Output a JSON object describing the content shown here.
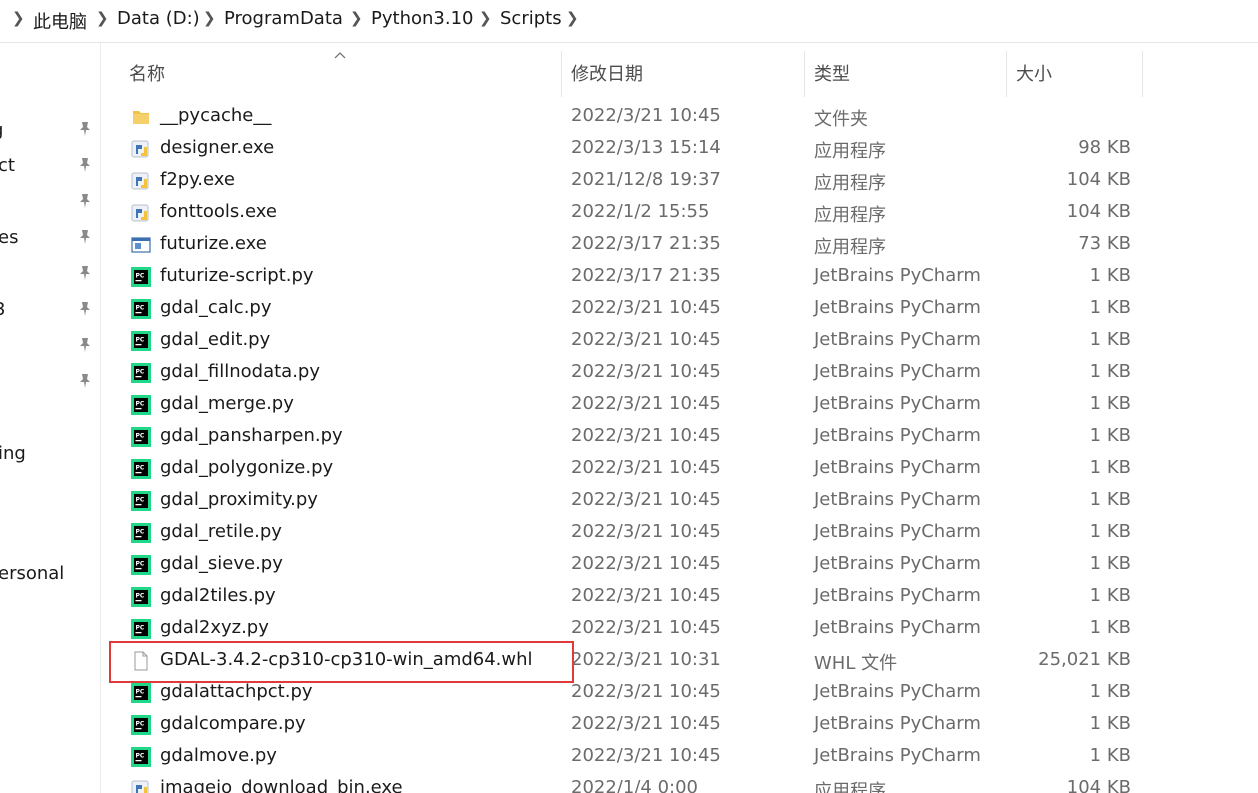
{
  "breadcrumb": [
    "此电脑",
    "Data (D:)",
    "ProgramData",
    "Python3.10",
    "Scripts"
  ],
  "nav": {
    "items": [
      "g",
      "ct",
      "",
      "es",
      "",
      "3",
      "",
      "",
      "ing",
      "ersonal"
    ]
  },
  "columns": {
    "name": "名称",
    "date": "修改日期",
    "type": "类型",
    "size": "大小"
  },
  "files": [
    {
      "name": "__pycache__",
      "date": "2022/3/21 10:45",
      "type": "文件夹",
      "size": "",
      "icon": "folder-icon"
    },
    {
      "name": "designer.exe",
      "date": "2022/3/13 15:14",
      "type": "应用程序",
      "size": "98 KB",
      "icon": "python-exe-icon"
    },
    {
      "name": "f2py.exe",
      "date": "2021/12/8 19:37",
      "type": "应用程序",
      "size": "104 KB",
      "icon": "python-exe-icon"
    },
    {
      "name": "fonttools.exe",
      "date": "2022/1/2 15:55",
      "type": "应用程序",
      "size": "104 KB",
      "icon": "python-exe-icon"
    },
    {
      "name": "futurize.exe",
      "date": "2022/3/17 21:35",
      "type": "应用程序",
      "size": "73 KB",
      "icon": "app-window-icon"
    },
    {
      "name": "futurize-script.py",
      "date": "2022/3/17 21:35",
      "type": "JetBrains PyCharm",
      "size": "1 KB",
      "icon": "pycharm-icon"
    },
    {
      "name": "gdal_calc.py",
      "date": "2022/3/21 10:45",
      "type": "JetBrains PyCharm",
      "size": "1 KB",
      "icon": "pycharm-icon"
    },
    {
      "name": "gdal_edit.py",
      "date": "2022/3/21 10:45",
      "type": "JetBrains PyCharm",
      "size": "1 KB",
      "icon": "pycharm-icon"
    },
    {
      "name": "gdal_fillnodata.py",
      "date": "2022/3/21 10:45",
      "type": "JetBrains PyCharm",
      "size": "1 KB",
      "icon": "pycharm-icon"
    },
    {
      "name": "gdal_merge.py",
      "date": "2022/3/21 10:45",
      "type": "JetBrains PyCharm",
      "size": "1 KB",
      "icon": "pycharm-icon"
    },
    {
      "name": "gdal_pansharpen.py",
      "date": "2022/3/21 10:45",
      "type": "JetBrains PyCharm",
      "size": "1 KB",
      "icon": "pycharm-icon"
    },
    {
      "name": "gdal_polygonize.py",
      "date": "2022/3/21 10:45",
      "type": "JetBrains PyCharm",
      "size": "1 KB",
      "icon": "pycharm-icon"
    },
    {
      "name": "gdal_proximity.py",
      "date": "2022/3/21 10:45",
      "type": "JetBrains PyCharm",
      "size": "1 KB",
      "icon": "pycharm-icon"
    },
    {
      "name": "gdal_retile.py",
      "date": "2022/3/21 10:45",
      "type": "JetBrains PyCharm",
      "size": "1 KB",
      "icon": "pycharm-icon"
    },
    {
      "name": "gdal_sieve.py",
      "date": "2022/3/21 10:45",
      "type": "JetBrains PyCharm",
      "size": "1 KB",
      "icon": "pycharm-icon"
    },
    {
      "name": "gdal2tiles.py",
      "date": "2022/3/21 10:45",
      "type": "JetBrains PyCharm",
      "size": "1 KB",
      "icon": "pycharm-icon"
    },
    {
      "name": "gdal2xyz.py",
      "date": "2022/3/21 10:45",
      "type": "JetBrains PyCharm",
      "size": "1 KB",
      "icon": "pycharm-icon"
    },
    {
      "name": "GDAL-3.4.2-cp310-cp310-win_amd64.whl",
      "date": "2022/3/21 10:31",
      "type": "WHL 文件",
      "size": "25,021 KB",
      "icon": "generic-file-icon",
      "highlighted": true
    },
    {
      "name": "gdalattachpct.py",
      "date": "2022/3/21 10:45",
      "type": "JetBrains PyCharm",
      "size": "1 KB",
      "icon": "pycharm-icon"
    },
    {
      "name": "gdalcompare.py",
      "date": "2022/3/21 10:45",
      "type": "JetBrains PyCharm",
      "size": "1 KB",
      "icon": "pycharm-icon"
    },
    {
      "name": "gdalmove.py",
      "date": "2022/3/21 10:45",
      "type": "JetBrains PyCharm",
      "size": "1 KB",
      "icon": "pycharm-icon"
    },
    {
      "name": "imageio_download_bin.exe",
      "date": "2022/1/4 0:00",
      "type": "应用程序",
      "size": "104 KB",
      "icon": "python-exe-icon"
    }
  ],
  "colors": {
    "highlight_border": "#e03a3a",
    "folder": "#f0c44c",
    "pycharm_green": "#21d789"
  }
}
